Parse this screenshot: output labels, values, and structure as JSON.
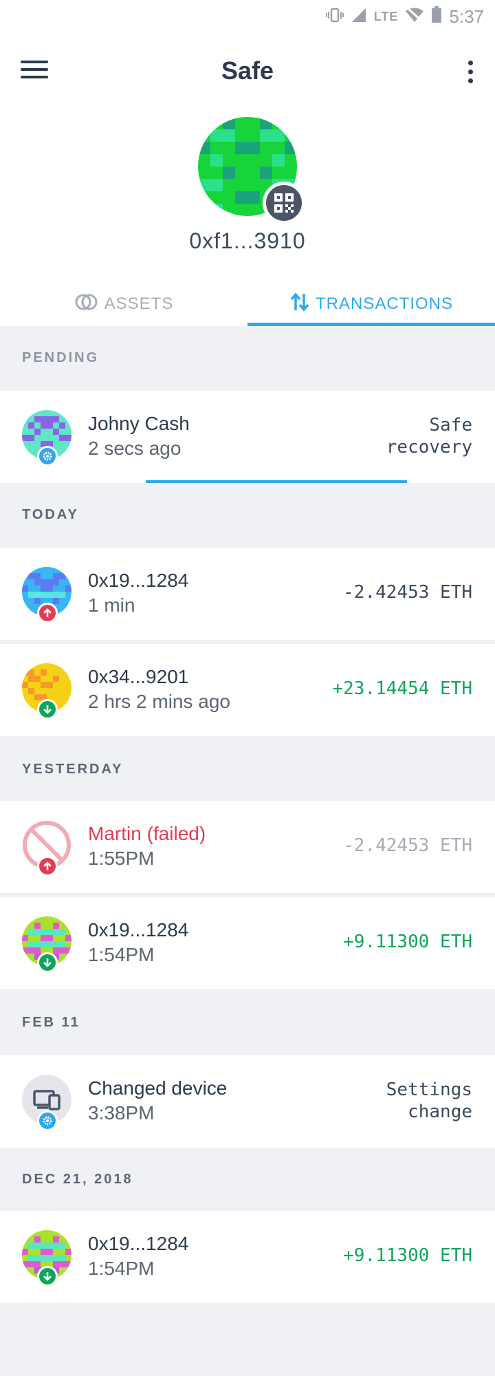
{
  "statusbar": {
    "lte": "LTE",
    "time": "5:37"
  },
  "header": {
    "title": "Safe",
    "address": "0xf1...3910"
  },
  "tabs": {
    "assets": "ASSETS",
    "transactions": "TRANSACTIONS"
  },
  "sections": {
    "pending": "PENDING",
    "today": "TODAY",
    "yesterday": "YESTERDAY",
    "feb11": "FEB 11",
    "dec21": "DEC 21, 2018"
  },
  "pending": {
    "name": "Johny Cash",
    "time": "2 secs ago",
    "type_line1": "Safe",
    "type_line2": "recovery"
  },
  "today": [
    {
      "name": "0x19...1284",
      "time": "1 min",
      "amount": "-2.42453 ETH"
    },
    {
      "name": "0x34...9201",
      "time": "2 hrs 2 mins ago",
      "amount": "+23.14454 ETH"
    }
  ],
  "yesterday": [
    {
      "name": "Martin (failed)",
      "time": "1:55PM",
      "amount": "-2.42453 ETH"
    },
    {
      "name": "0x19...1284",
      "time": "1:54PM",
      "amount": "+9.11300 ETH"
    }
  ],
  "feb11": {
    "name": "Changed device",
    "time": "3:38PM",
    "type_line1": "Settings",
    "type_line2": "change"
  },
  "dec21": {
    "name": "0x19...1284",
    "time": "1:54PM",
    "amount": "+9.11300 ETH"
  },
  "colors": {
    "accent": "#2ea8e8",
    "positive": "#0fa55a",
    "negative": "#e23b53",
    "text": "#2b3a4e"
  }
}
